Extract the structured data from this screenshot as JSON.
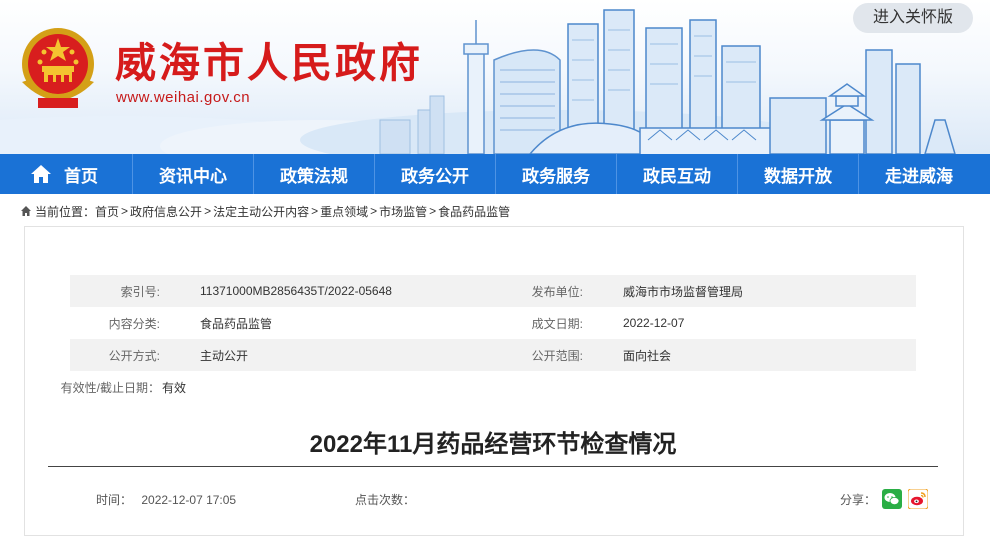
{
  "header": {
    "site_title": "威海市人民政府",
    "site_url": "www.weihai.gov.cn",
    "care_version_label": "进入关怀版"
  },
  "nav": {
    "items": [
      {
        "label": "首页"
      },
      {
        "label": "资讯中心"
      },
      {
        "label": "政策法规"
      },
      {
        "label": "政务公开"
      },
      {
        "label": "政务服务"
      },
      {
        "label": "政民互动"
      },
      {
        "label": "数据开放"
      },
      {
        "label": "走进威海"
      }
    ],
    "color": "#1a72d6"
  },
  "breadcrumb": {
    "prefix": "当前位置：",
    "items": [
      "首页",
      "政府信息公开",
      "法定主动公开内容",
      "重点领域",
      "市场监管",
      "食品药品监管"
    ],
    "separator": ">"
  },
  "meta": {
    "index_no_label": "索引号:",
    "index_no": "11371000MB2856435T/2022-05648",
    "publisher_label": "发布单位:",
    "publisher": "威海市市场监督管理局",
    "category_label": "内容分类:",
    "category": "食品药品监管",
    "date_label": "成文日期:",
    "date": "2022-12-07",
    "method_label": "公开方式:",
    "method": "主动公开",
    "scope_label": "公开范围:",
    "scope": "面向社会",
    "validity_label": "有效性/截止日期：",
    "validity": "有效"
  },
  "article": {
    "title": "2022年11月药品经营环节检查情况",
    "time_label": "时间：",
    "time": "2022-12-07 17:05",
    "clicks_label": "点击次数：",
    "share_label": "分享："
  }
}
